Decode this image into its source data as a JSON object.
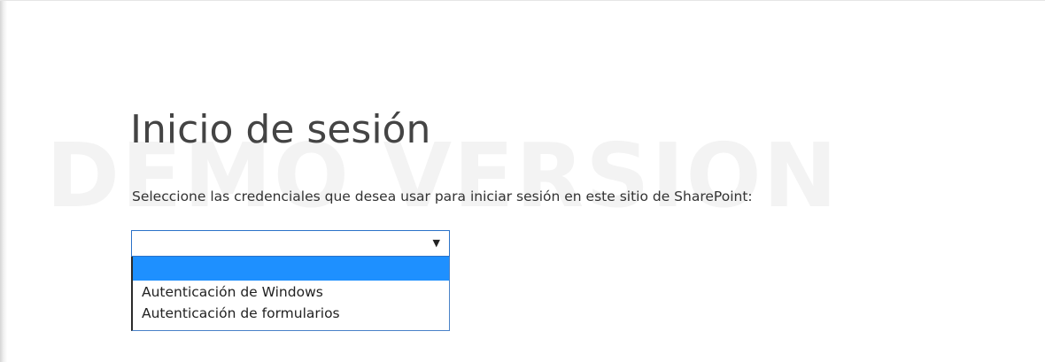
{
  "watermark": {
    "text": "DEMO VERSION"
  },
  "signin": {
    "title": "Inicio de sesión",
    "instructions": "Seleccione las credenciales que desea usar para iniciar sesión en este sitio de SharePoint:"
  },
  "credential_select": {
    "selected_value": "",
    "arrow_icon": "dropdown-arrow-icon",
    "options": [
      {
        "label": "",
        "highlighted": true
      },
      {
        "label": "Autenticación de Windows",
        "highlighted": false
      },
      {
        "label": "Autenticación de formularios",
        "highlighted": false
      }
    ]
  },
  "colors": {
    "highlight": "#1e90ff",
    "select_border": "#2b72c8",
    "title_text": "#444444",
    "watermark_text": "#f3f3f3"
  }
}
